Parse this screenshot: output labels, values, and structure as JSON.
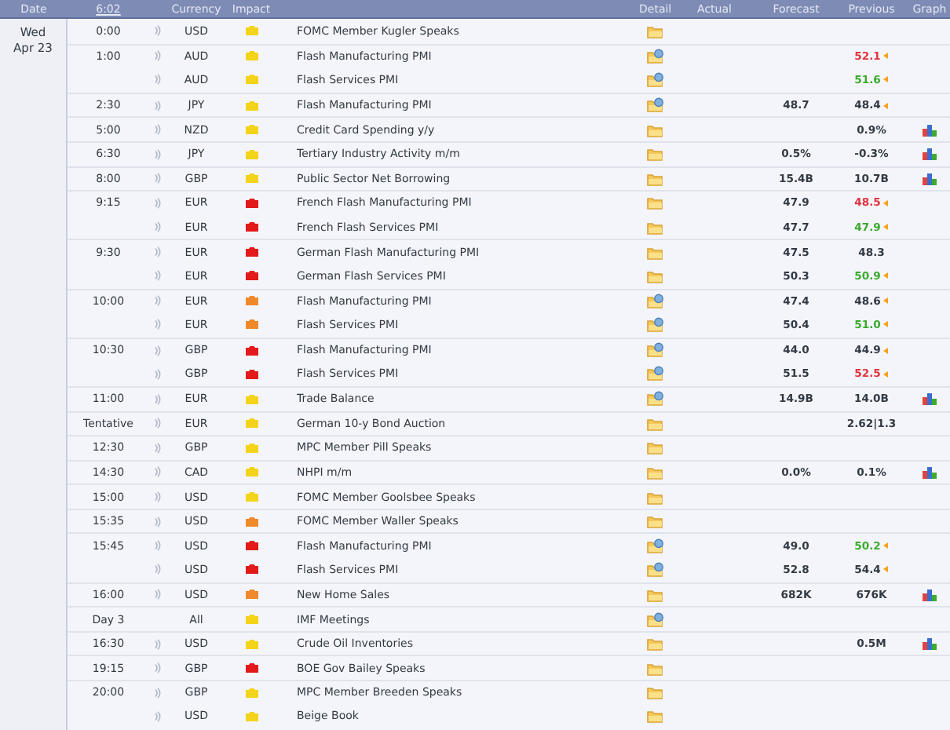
{
  "header": {
    "columns": [
      {
        "kind": "date",
        "label": "Date"
      },
      {
        "kind": "clock",
        "label": "6:02"
      },
      {
        "kind": "currency",
        "label": "Currency"
      },
      {
        "kind": "impact",
        "label": "Impact"
      },
      {
        "kind": "detail",
        "label": "Detail"
      },
      {
        "kind": "actual",
        "label": "Actual"
      },
      {
        "kind": "forecast",
        "label": "Forecast"
      },
      {
        "kind": "previous",
        "label": "Previous"
      },
      {
        "kind": "graph",
        "label": "Graph"
      }
    ]
  },
  "date": {
    "weekday": "Wed",
    "day": "Apr 23"
  },
  "rows": [
    {
      "time": "0:00",
      "sound": true,
      "currency": "USD",
      "color": "#f3d41a",
      "event": "FOMC Member Kugler Speaks",
      "news": false,
      "graph": false
    },
    {
      "time": "1:00",
      "sound": true,
      "currency": "AUD",
      "color": "#f3d41a",
      "event": "Flash Manufacturing PMI",
      "news": true,
      "previous": "52.1",
      "revised": true,
      "better": false,
      "worse": true,
      "graph": false
    },
    {
      "sound": true,
      "currency": "AUD",
      "color": "#f3d41a",
      "event": "Flash Services PMI",
      "news": true,
      "previous": "51.6",
      "revised": true,
      "better": true,
      "worse": false,
      "graph": false
    },
    {
      "time": "2:30",
      "sound": true,
      "currency": "JPY",
      "color": "#f3d41a",
      "event": "Flash Manufacturing PMI",
      "news": true,
      "forecast": "48.7",
      "previous": "48.4",
      "revised": true,
      "better": false,
      "worse": false,
      "graph": false
    },
    {
      "time": "5:00",
      "sound": true,
      "currency": "NZD",
      "color": "#f3d41a",
      "event": "Credit Card Spending y/y",
      "news": false,
      "previous": "0.9%",
      "revised": false,
      "better": false,
      "worse": false,
      "graph": true
    },
    {
      "time": "6:30",
      "sound": true,
      "currency": "JPY",
      "color": "#f3d41a",
      "event": "Tertiary Industry Activity m/m",
      "news": false,
      "forecast": "0.5%",
      "previous": "-0.3%",
      "revised": false,
      "better": false,
      "worse": false,
      "graph": true
    },
    {
      "time": "8:00",
      "sound": true,
      "currency": "GBP",
      "color": "#f3d41a",
      "event": "Public Sector Net Borrowing",
      "news": false,
      "forecast": "15.4B",
      "previous": "10.7B",
      "revised": false,
      "better": false,
      "worse": false,
      "graph": true
    },
    {
      "time": "9:15",
      "sound": true,
      "currency": "EUR",
      "color": "#e21a1a",
      "event": "French Flash Manufacturing PMI",
      "news": false,
      "forecast": "47.9",
      "previous": "48.5",
      "revised": true,
      "better": false,
      "worse": true,
      "graph": false
    },
    {
      "sound": true,
      "currency": "EUR",
      "color": "#e21a1a",
      "event": "French Flash Services PMI",
      "news": false,
      "forecast": "47.7",
      "previous": "47.9",
      "revised": true,
      "better": true,
      "worse": false,
      "graph": false
    },
    {
      "time": "9:30",
      "sound": true,
      "currency": "EUR",
      "color": "#e21a1a",
      "event": "German Flash Manufacturing PMI",
      "news": false,
      "forecast": "47.5",
      "previous": "48.3",
      "revised": false,
      "better": false,
      "worse": false,
      "graph": false
    },
    {
      "sound": true,
      "currency": "EUR",
      "color": "#e21a1a",
      "event": "German Flash Services PMI",
      "news": false,
      "forecast": "50.3",
      "previous": "50.9",
      "revised": true,
      "better": true,
      "worse": false,
      "graph": false
    },
    {
      "time": "10:00",
      "sound": true,
      "currency": "EUR",
      "color": "#f0892a",
      "event": "Flash Manufacturing PMI",
      "news": true,
      "forecast": "47.4",
      "previous": "48.6",
      "revised": true,
      "better": false,
      "worse": false,
      "graph": false
    },
    {
      "sound": true,
      "currency": "EUR",
      "color": "#f0892a",
      "event": "Flash Services PMI",
      "news": true,
      "forecast": "50.4",
      "previous": "51.0",
      "revised": true,
      "better": true,
      "worse": false,
      "graph": false
    },
    {
      "time": "10:30",
      "sound": true,
      "currency": "GBP",
      "color": "#e21a1a",
      "event": "Flash Manufacturing PMI",
      "news": true,
      "forecast": "44.0",
      "previous": "44.9",
      "revised": true,
      "better": false,
      "worse": false,
      "graph": false
    },
    {
      "sound": true,
      "currency": "GBP",
      "color": "#e21a1a",
      "event": "Flash Services PMI",
      "news": true,
      "forecast": "51.5",
      "previous": "52.5",
      "revised": true,
      "better": false,
      "worse": true,
      "graph": false
    },
    {
      "time": "11:00",
      "sound": true,
      "currency": "EUR",
      "color": "#f3d41a",
      "event": "Trade Balance",
      "news": true,
      "forecast": "14.9B",
      "previous": "14.0B",
      "revised": false,
      "better": false,
      "worse": false,
      "graph": true
    },
    {
      "time": "Tentative",
      "sound": true,
      "currency": "EUR",
      "color": "#f3d41a",
      "event": "German 10-y Bond Auction",
      "news": false,
      "previous": "2.62|1.3",
      "revised": false,
      "better": false,
      "worse": false,
      "graph": false
    },
    {
      "time": "12:30",
      "sound": true,
      "currency": "GBP",
      "color": "#f3d41a",
      "event": "MPC Member Pill Speaks",
      "news": false,
      "graph": false
    },
    {
      "time": "14:30",
      "sound": true,
      "currency": "CAD",
      "color": "#f3d41a",
      "event": "NHPI m/m",
      "news": false,
      "forecast": "0.0%",
      "previous": "0.1%",
      "revised": false,
      "better": false,
      "worse": false,
      "graph": true
    },
    {
      "time": "15:00",
      "sound": true,
      "currency": "USD",
      "color": "#f3d41a",
      "event": "FOMC Member Goolsbee Speaks",
      "news": false,
      "graph": false
    },
    {
      "time": "15:35",
      "sound": true,
      "currency": "USD",
      "color": "#f0892a",
      "event": "FOMC Member Waller Speaks",
      "news": false,
      "graph": false
    },
    {
      "time": "15:45",
      "sound": true,
      "currency": "USD",
      "color": "#e21a1a",
      "event": "Flash Manufacturing PMI",
      "news": true,
      "forecast": "49.0",
      "previous": "50.2",
      "revised": true,
      "better": true,
      "worse": false,
      "graph": false
    },
    {
      "sound": true,
      "currency": "USD",
      "color": "#e21a1a",
      "event": "Flash Services PMI",
      "news": true,
      "forecast": "52.8",
      "previous": "54.4",
      "revised": true,
      "better": false,
      "worse": false,
      "graph": false
    },
    {
      "time": "16:00",
      "sound": true,
      "currency": "USD",
      "color": "#f0892a",
      "event": "New Home Sales",
      "news": false,
      "forecast": "682K",
      "previous": "676K",
      "revised": false,
      "better": false,
      "worse": false,
      "graph": true
    },
    {
      "time": "Day 3",
      "sound": false,
      "currency": "All",
      "color": "#f3d41a",
      "event": "IMF Meetings",
      "news": true,
      "graph": false
    },
    {
      "time": "16:30",
      "sound": true,
      "currency": "USD",
      "color": "#f3d41a",
      "event": "Crude Oil Inventories",
      "news": false,
      "previous": "0.5M",
      "revised": false,
      "better": false,
      "worse": false,
      "graph": true
    },
    {
      "time": "19:15",
      "sound": true,
      "currency": "GBP",
      "color": "#e21a1a",
      "event": "BOE Gov Bailey Speaks",
      "news": false,
      "graph": false
    },
    {
      "time": "20:00",
      "sound": true,
      "currency": "GBP",
      "color": "#f3d41a",
      "event": "MPC Member Breeden Speaks",
      "news": false,
      "graph": false
    },
    {
      "sound": true,
      "currency": "USD",
      "color": "#f3d41a",
      "event": "Beige Book",
      "news": false,
      "graph": false
    }
  ]
}
